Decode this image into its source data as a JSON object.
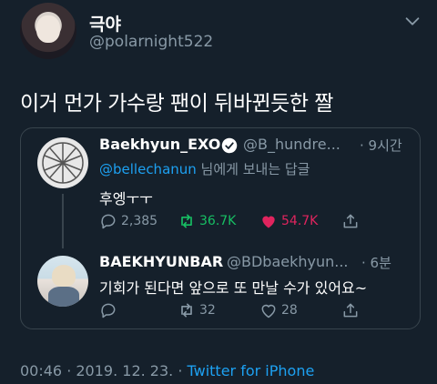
{
  "author": {
    "name": "극야",
    "handle": "@polarnight522"
  },
  "tweet": {
    "text": "이거 먼가 가수랑 팬이 뒤바뀐듯한 짤"
  },
  "quote": {
    "first": {
      "name": "Baekhyun_EXO",
      "handle": "@B_hundre...",
      "time": "· 9시간",
      "reply_mention": "@bellechanun",
      "reply_suffix": " 님에게 보내는 답글",
      "text": "후엥ㅜㅜ",
      "replies": "2,385",
      "retweets": "36.7K",
      "likes": "54.7K"
    },
    "second": {
      "name": "BAEKHYUNBAR",
      "handle": "@BDbaekhyun...",
      "time": "· 6분",
      "text": "기회가 된다면 앞으로 또 만날 수가 있어요~",
      "replies": "",
      "retweets": "32",
      "likes": "28"
    }
  },
  "footer": {
    "datetime": "00:46 · 2019. 12. 23. · ",
    "app": "Twitter for iPhone"
  },
  "colors": {
    "background": "#15202b",
    "link": "#1da1f2",
    "retweet_active": "#17bf63",
    "like_active": "#e0245e",
    "muted": "#8899a6"
  }
}
